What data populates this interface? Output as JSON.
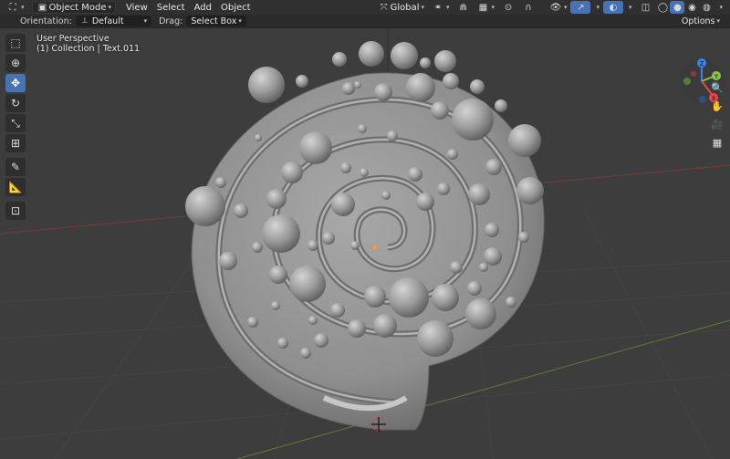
{
  "header": {
    "editor_icon": "view3d-icon",
    "mode": "Object Mode",
    "menus": [
      "View",
      "Select",
      "Add",
      "Object"
    ],
    "transform_orientation": "Global",
    "options": "Options"
  },
  "tool_settings": {
    "orientation_label": "Orientation:",
    "orientation_value": "Default",
    "drag_label": "Drag:",
    "drag_value": "Select Box"
  },
  "viewport": {
    "perspective": "User Perspective",
    "collection": "(1) Collection | Text.011"
  },
  "gizmo": {
    "x": "X",
    "y": "Y",
    "z": "Z",
    "x_color": "#e8464c",
    "y_color": "#8bc34a",
    "z_color": "#3f84e5"
  },
  "left_tools": [
    "select-box-icon",
    "cursor-icon",
    "move-icon",
    "rotate-icon",
    "scale-icon",
    "transform-icon",
    "annotate-icon",
    "measure-icon",
    "add-cube-icon"
  ],
  "right_nav": [
    "zoom-icon",
    "pan-hand-icon",
    "camera-icon",
    "grid-view-icon"
  ],
  "colors": {
    "accent": "#4772b3",
    "header": "#303030",
    "viewport_bg": "#3d3d3d",
    "mesh": "#9d9d9d"
  }
}
